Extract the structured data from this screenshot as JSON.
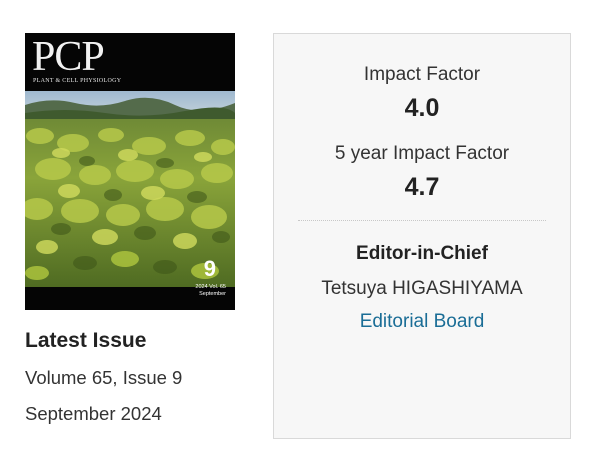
{
  "cover": {
    "logo": "PCP",
    "subtitle": "PLANT & CELL PHYSIOLOGY",
    "issue_number": "9",
    "volume_line": "2024 Vol. 65",
    "month_line": "September"
  },
  "latest_issue": {
    "heading": "Latest Issue",
    "volume_issue": "Volume 65, Issue 9",
    "date": "September 2024"
  },
  "metrics": {
    "impact_factor_label": "Impact Factor",
    "impact_factor_value": "4.0",
    "five_year_label": "5 year Impact Factor",
    "five_year_value": "4.7"
  },
  "editor": {
    "label": "Editor-in-Chief",
    "name": "Tetsuya HIGASHIYAMA",
    "board_link": "Editorial Board"
  },
  "colors": {
    "link": "#1a6d96",
    "panel_bg": "#f7f7f7",
    "panel_border": "#d9d9d9",
    "cover_bg": "#050505"
  }
}
